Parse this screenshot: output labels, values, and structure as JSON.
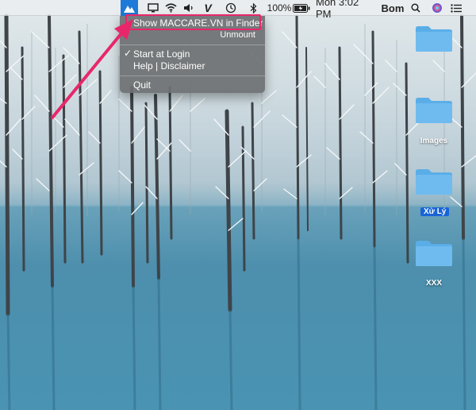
{
  "menubar": {
    "app_icon": "maccare-mountain-icon",
    "icons": [
      "display-icon",
      "screen-mirror-icon",
      "wifi-icon",
      "volume-icon",
      "vysor-icon",
      "time-machine-icon",
      "bluetooth-icon"
    ],
    "battery_percent": "100%",
    "clock": "Mon 3:02 PM",
    "user": "Bom",
    "right_icons": [
      "search-icon",
      "siri-icon",
      "notification-list-icon"
    ]
  },
  "menu": {
    "show_in_finder": "Show MACCARE.VN in Finder",
    "unmount": "Unmount",
    "start_at_login": "Start at Login",
    "start_at_login_checked": true,
    "help_disclaimer": "Help | Disclaimer",
    "quit": "Quit"
  },
  "desktop": {
    "folders": [
      {
        "label": ""
      },
      {
        "label": "Images"
      },
      {
        "label": "Xử Lý",
        "selected": true
      },
      {
        "label": "XXX"
      }
    ]
  },
  "colors": {
    "highlight": "#e8276a",
    "folder": "#69b8ee",
    "selection": "#1864d6",
    "menu_bg": "#6e7072"
  }
}
